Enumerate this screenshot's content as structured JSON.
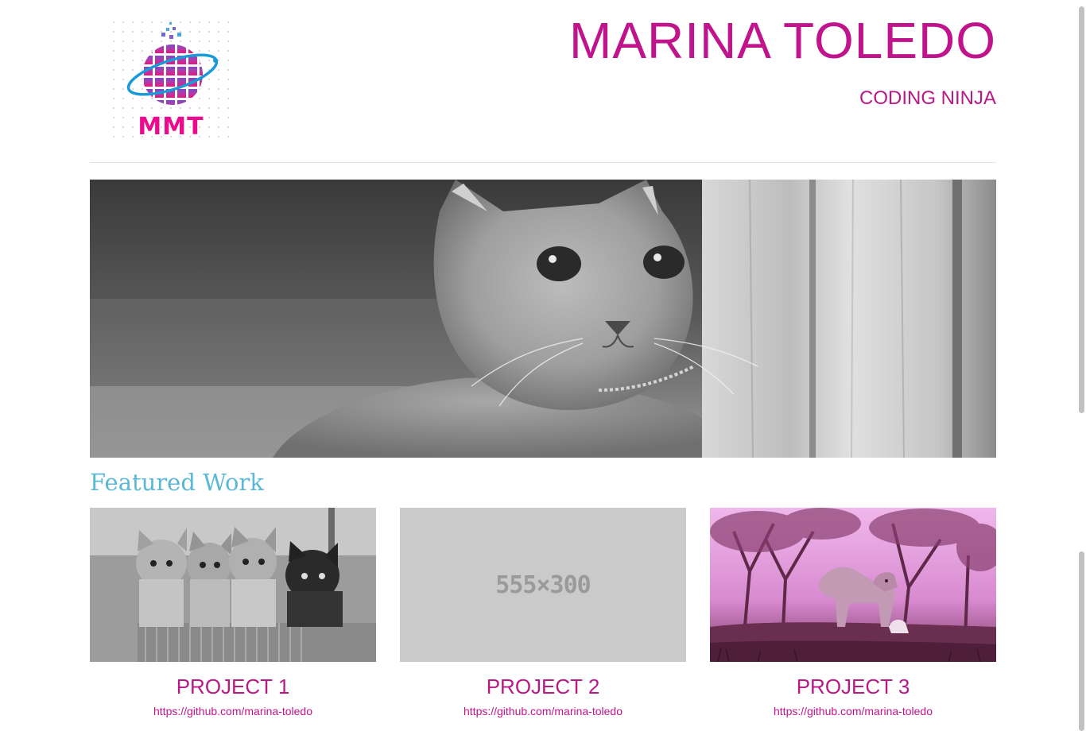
{
  "header": {
    "logo_text": "MMT",
    "title": "MARINA TOLEDO",
    "subtitle": "CODING NINJA"
  },
  "featured": {
    "heading": "Featured Work",
    "projects": [
      {
        "title": "PROJECT 1",
        "link": "https://github.com/marina-toledo"
      },
      {
        "title": "PROJECT 2",
        "link": "https://github.com/marina-toledo",
        "placeholder": "555×300"
      },
      {
        "title": "PROJECT 3",
        "link": "https://github.com/marina-toledo"
      }
    ]
  },
  "colors": {
    "accent": "#c0148c",
    "heading": "#5bb8d4",
    "logo": "#ec0b8c"
  }
}
